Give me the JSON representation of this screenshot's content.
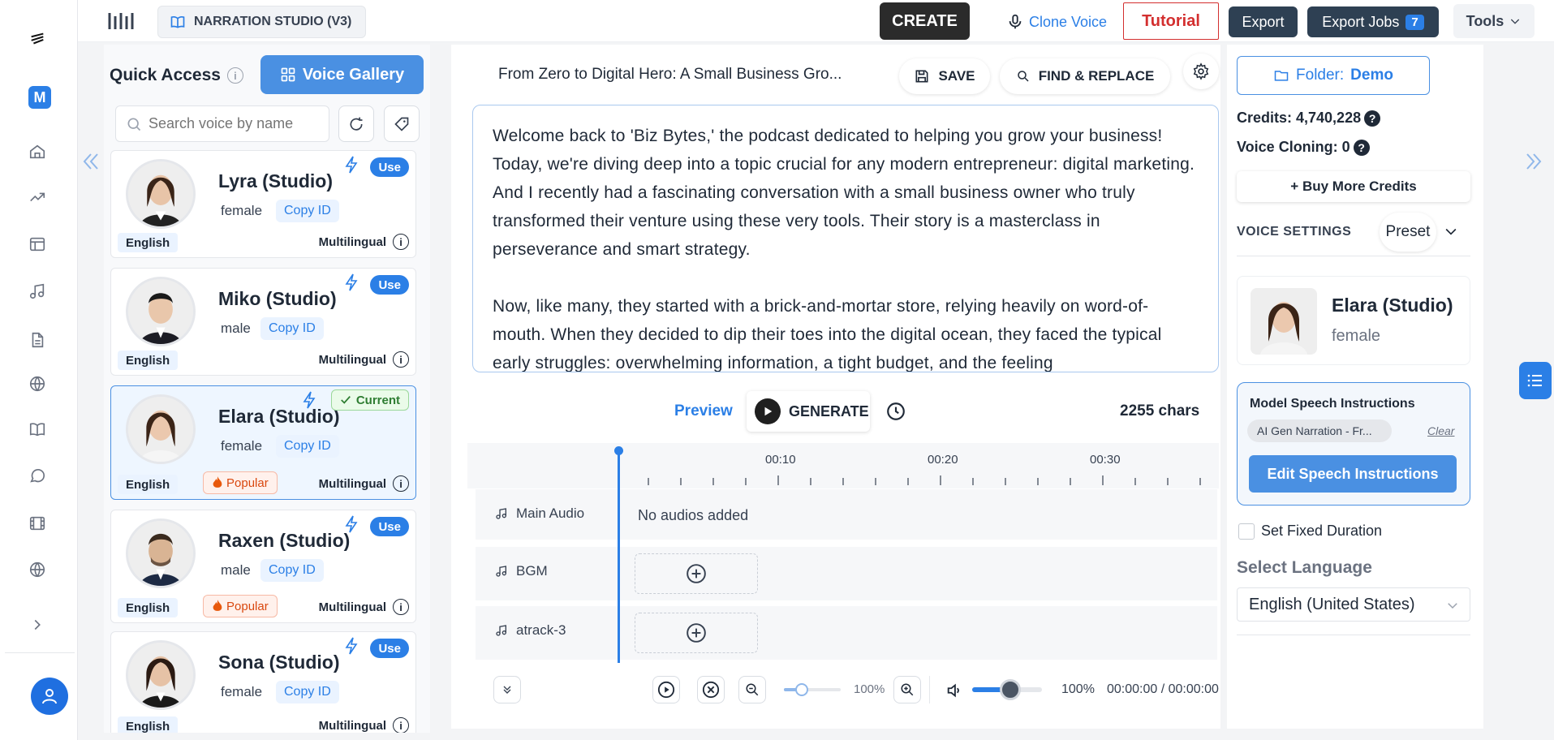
{
  "colors": {
    "accent": "#2b7fe6",
    "dark": "#2b2b2b",
    "tutorial_red": "#d32f2f",
    "export_bg": "#2e4053"
  },
  "topbar": {
    "project_label": "NARRATION STUDIO (V3)",
    "create": "CREATE",
    "clone_voice": "Clone Voice",
    "tutorial": "Tutorial",
    "export": "Export",
    "export_jobs": "Export Jobs",
    "export_jobs_count": "7",
    "tools": "Tools"
  },
  "rail": {
    "workspace_initial": "M"
  },
  "quick_access": {
    "title": "Quick Access",
    "gallery_button": "Voice Gallery",
    "search_placeholder": "Search voice by name",
    "voices": [
      {
        "name": "Lyra (Studio)",
        "gender": "female",
        "copy_id": "Copy ID",
        "language": "English",
        "model": "Multilingual",
        "action": "Use",
        "popular": ""
      },
      {
        "name": "Miko (Studio)",
        "gender": "male",
        "copy_id": "Copy ID",
        "language": "English",
        "model": "Multilingual",
        "action": "Use",
        "popular": ""
      },
      {
        "name": "Elara (Studio)",
        "gender": "female",
        "copy_id": "Copy ID",
        "language": "English",
        "model": "Multilingual",
        "action": "Current",
        "popular": "Popular"
      },
      {
        "name": "Raxen (Studio)",
        "gender": "male",
        "copy_id": "Copy ID",
        "language": "English",
        "model": "Multilingual",
        "action": "Use",
        "popular": "Popular"
      },
      {
        "name": "Sona (Studio)",
        "gender": "female",
        "copy_id": "Copy ID",
        "language": "English",
        "model": "Multilingual",
        "action": "Use",
        "popular": ""
      }
    ]
  },
  "editor": {
    "project_title": "From Zero to Digital Hero: A Small Business Gro...",
    "save": "SAVE",
    "find_replace": "FIND & REPLACE",
    "paragraph1": "Welcome back to 'Biz Bytes,' the podcast dedicated to helping you grow your business! Today, we're diving deep into a topic crucial for any modern entrepreneur: digital marketing. And I recently had a fascinating conversation with a small business owner who truly transformed their venture using these very tools. Their story is a masterclass in perseverance and smart strategy.",
    "paragraph2": "Now, like many, they started with a brick-and-mortar store, relying heavily on word-of-mouth. When they decided to dip their toes into the digital ocean, they faced the typical early struggles: overwhelming information, a tight budget, and the feeling",
    "preview": "Preview",
    "generate": "GENERATE",
    "char_count": "2255 chars"
  },
  "timeline": {
    "ticks": [
      "00:10",
      "00:20",
      "00:30"
    ],
    "tracks": [
      {
        "label": "Main Audio",
        "content": "No audios added"
      },
      {
        "label": "BGM",
        "content": ""
      },
      {
        "label": "atrack-3",
        "content": ""
      }
    ],
    "zoom": "100%",
    "volume": "100%",
    "time": "00:00:00 / 00:00:00"
  },
  "right_panel": {
    "folder_label": "Folder:",
    "folder_name": "Demo",
    "credits": "Credits: 4,740,228",
    "voice_cloning": "Voice Cloning: 0",
    "buy_credits": "+ Buy More Credits",
    "voice_settings": "VOICE SETTINGS",
    "preset": "Preset",
    "selected_voice": {
      "name": "Elara (Studio)",
      "gender": "female"
    },
    "speech_instructions_title": "Model Speech Instructions",
    "speech_chip": "AI Gen Narration - Fr...",
    "clear": "Clear",
    "edit_instructions": "Edit Speech Instructions",
    "fixed_duration": "Set Fixed Duration",
    "select_language": "Select Language",
    "language_value": "English (United States)"
  }
}
